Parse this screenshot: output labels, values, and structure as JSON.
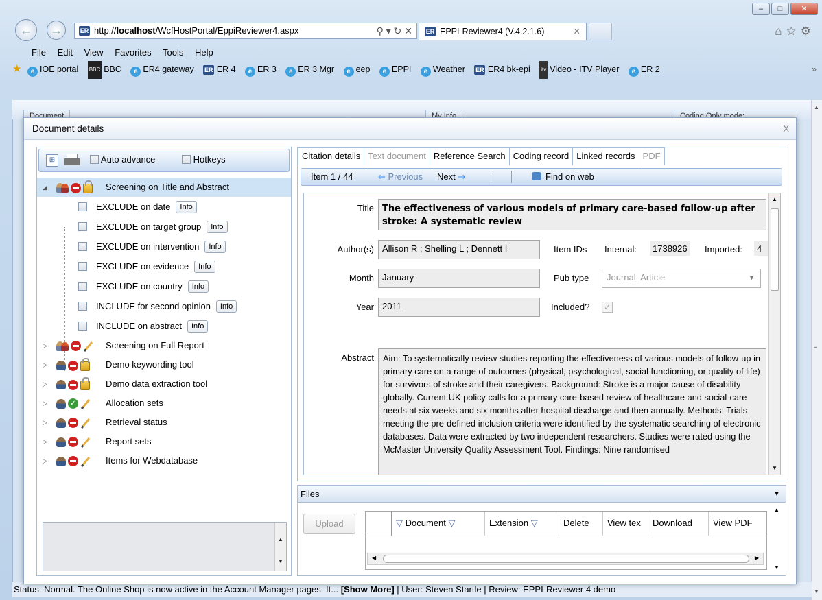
{
  "browser": {
    "url_prefix": "http://",
    "url_host": "localhost",
    "url_path": "/WcfHostPortal/EppiReviewer4.aspx",
    "favicon_text": "ER",
    "tab_title": "EPPI-Reviewer4 (V.4.2.1.6)",
    "window_controls": [
      "–",
      "□",
      "✕"
    ]
  },
  "menu": [
    "File",
    "Edit",
    "View",
    "Favorites",
    "Tools",
    "Help"
  ],
  "favorites": [
    {
      "icon": "ie-icon",
      "label": "IOE portal"
    },
    {
      "icon": "bbc-icon",
      "label": "BBC"
    },
    {
      "icon": "ie-icon",
      "label": "ER4 gateway"
    },
    {
      "icon": "er-icon",
      "label": "ER 4"
    },
    {
      "icon": "ie-icon",
      "label": "ER 3"
    },
    {
      "icon": "ie-icon",
      "label": "ER 3 Mgr"
    },
    {
      "icon": "ie-icon",
      "label": "eep"
    },
    {
      "icon": "ie-icon",
      "label": "EPPI"
    },
    {
      "icon": "ie-icon",
      "label": "Weather"
    },
    {
      "icon": "er-icon",
      "label": "ER4 bk-epi"
    },
    {
      "icon": "itv-icon",
      "label": "Video - ITV Player"
    },
    {
      "icon": "ie-icon",
      "label": "ER 2"
    }
  ],
  "background": {
    "tab_left": "Document",
    "tab_mid": "My Info",
    "coding_only": "Coding Only mode:"
  },
  "dialog": {
    "title": "Document details",
    "close": "X"
  },
  "left_toolbar": {
    "auto_advance": "Auto advance",
    "hotkeys": "Hotkeys"
  },
  "tree": {
    "root": {
      "label": "Screening on Title and Abstract"
    },
    "children": [
      {
        "label": "EXCLUDE on date",
        "info": "Info"
      },
      {
        "label": "EXCLUDE on target group",
        "info": "Info"
      },
      {
        "label": "EXCLUDE on intervention",
        "info": "Info"
      },
      {
        "label": "EXCLUDE on evidence",
        "info": "Info"
      },
      {
        "label": "EXCLUDE on country",
        "info": "Info"
      },
      {
        "label": "INCLUDE for second opinion",
        "info": "Info"
      },
      {
        "label": "INCLUDE on abstract",
        "info": "Info"
      }
    ],
    "sets": [
      {
        "label": "Screening on Full Report",
        "user": "multi",
        "status": "noentry",
        "type": "pencil"
      },
      {
        "label": "Demo keywording tool",
        "user": "single",
        "status": "noentry",
        "type": "lock"
      },
      {
        "label": "Demo data extraction tool",
        "user": "single",
        "status": "noentry",
        "type": "lock"
      },
      {
        "label": "Allocation sets",
        "user": "single",
        "status": "ok",
        "type": "pencil"
      },
      {
        "label": "Retrieval status",
        "user": "single",
        "status": "noentry",
        "type": "pencil"
      },
      {
        "label": "Report sets",
        "user": "single",
        "status": "noentry",
        "type": "pencil"
      },
      {
        "label": "Items for Webdatabase",
        "user": "single",
        "status": "noentry",
        "type": "pencil"
      }
    ]
  },
  "tabs": [
    "Citation details",
    "Text document",
    "Reference Search",
    "Coding record",
    "Linked records",
    "PDF"
  ],
  "itembar": {
    "position": "Item 1 / 44",
    "previous": "Previous",
    "next": "Next",
    "find": "Find on web"
  },
  "citation": {
    "title_label": "Title",
    "title": "The effectiveness of various models of primary care-based follow-up after stroke: A systematic review",
    "authors_label": "Author(s)",
    "authors": "Allison R ; Shelling L ; Dennett I",
    "month_label": "Month",
    "month": "January",
    "year_label": "Year",
    "year": "2011",
    "item_ids_label": "Item IDs",
    "internal_label": "Internal:",
    "internal_id": "1738926",
    "imported_label": "Imported:",
    "imported_id": "4",
    "pubtype_label": "Pub type",
    "pubtype": "Journal, Article",
    "included_label": "Included?",
    "abstract_label": "Abstract",
    "abstract": "Aim: To systematically review studies reporting the effectiveness of various models of follow-up in primary care on a range of outcomes (physical, psychological, social functioning, or quality of life) for survivors of stroke and their caregivers. Background: Stroke is a major cause of disability globally. Current UK policy calls for a primary care-based review of healthcare and social-care needs at six weeks and six months after hospital discharge and then annually. Methods: Trials meeting the pre-defined inclusion criteria were identified by the systematic searching of electronic databases. Data were extracted by two independent researchers. Studies were rated using the McMaster University Quality Assessment Tool. Findings: Nine randomised"
  },
  "files": {
    "header": "Files",
    "upload": "Upload",
    "columns": [
      "Document",
      "Extension",
      "Delete",
      "View tex",
      "Download",
      "View PDF"
    ]
  },
  "status": {
    "text": "Status: Normal. The Online Shop is now active in the Account Manager pages. It... ",
    "show_more": "[Show More]",
    "user": " | User: Steven Startle | Review: EPPI-Reviewer 4 demo"
  }
}
